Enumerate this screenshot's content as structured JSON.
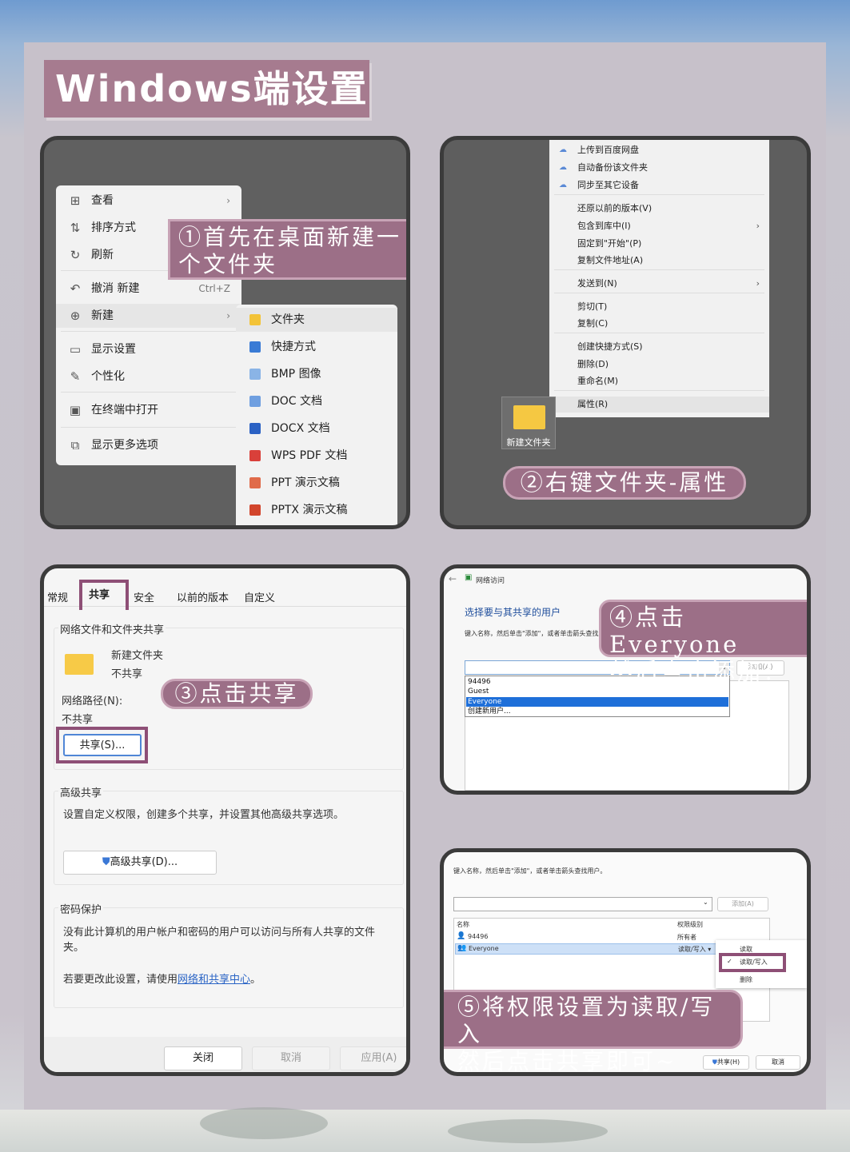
{
  "title": "Windows端设置",
  "panel1": {
    "note": [
      "①首先在桌面新建一",
      "个文件夹"
    ],
    "menu": [
      {
        "icon": "grid-icon",
        "glyph": "⊞",
        "label": "查看",
        "right": "›"
      },
      {
        "icon": "sort-icon",
        "glyph": "⇅",
        "label": "排序方式",
        "right": "›"
      },
      {
        "icon": "refresh-icon",
        "glyph": "↻",
        "label": "刷新",
        "right": ""
      },
      {
        "icon": "undo-icon",
        "glyph": "↶",
        "label": "撤消 新建",
        "right": "Ctrl+Z"
      },
      {
        "icon": "new-icon",
        "glyph": "⊕",
        "label": "新建",
        "right": "›"
      },
      {
        "icon": "display-icon",
        "glyph": "▭",
        "label": "显示设置",
        "right": ""
      },
      {
        "icon": "brush-icon",
        "glyph": "✎",
        "label": "个性化",
        "right": ""
      },
      {
        "icon": "terminal-icon",
        "glyph": "▣",
        "label": "在终端中打开",
        "right": ""
      },
      {
        "icon": "more-options-icon",
        "glyph": "⧉",
        "label": "显示更多选项",
        "right": ""
      }
    ],
    "submenu": [
      {
        "icon": "folder-icon",
        "color": "#f3c338",
        "label": "文件夹"
      },
      {
        "icon": "shortcut-icon",
        "color": "#3a7bd5",
        "label": "快捷方式"
      },
      {
        "icon": "bmp-icon",
        "color": "#8ab4e6",
        "label": "BMP 图像"
      },
      {
        "icon": "doc-icon",
        "color": "#6f9fe0",
        "label": "DOC 文档"
      },
      {
        "icon": "docx-icon",
        "color": "#2b62c4",
        "label": "DOCX 文档"
      },
      {
        "icon": "pdf-icon",
        "color": "#d9403a",
        "label": "WPS PDF 文档"
      },
      {
        "icon": "ppt-icon",
        "color": "#e06b4a",
        "label": "PPT 演示文稿"
      },
      {
        "icon": "pptx-icon",
        "color": "#d2452c",
        "label": "PPTX 演示文稿"
      }
    ]
  },
  "panel2": {
    "note": "②右键文件夹-属性",
    "folder_label": "新建文件夹",
    "menu": [
      {
        "label": "上传到百度网盘",
        "icon": "cloud-icon",
        "arrow": ""
      },
      {
        "label": "自动备份该文件夹",
        "icon": "cloud-icon",
        "arrow": ""
      },
      {
        "label": "同步至其它设备",
        "icon": "cloud-icon",
        "arrow": ""
      },
      {
        "label": "还原以前的版本(V)",
        "icon": "",
        "arrow": ""
      },
      {
        "label": "包含到库中(I)",
        "icon": "",
        "arrow": "›"
      },
      {
        "label": "固定到\"开始\"(P)",
        "icon": "",
        "arrow": ""
      },
      {
        "label": "复制文件地址(A)",
        "icon": "",
        "arrow": ""
      },
      {
        "label": "发送到(N)",
        "icon": "",
        "arrow": "›"
      },
      {
        "label": "剪切(T)",
        "icon": "",
        "arrow": ""
      },
      {
        "label": "复制(C)",
        "icon": "",
        "arrow": ""
      },
      {
        "label": "创建快捷方式(S)",
        "icon": "",
        "arrow": ""
      },
      {
        "label": "删除(D)",
        "icon": "",
        "arrow": ""
      },
      {
        "label": "重命名(M)",
        "icon": "",
        "arrow": ""
      },
      {
        "label": "属性(R)",
        "icon": "",
        "arrow": ""
      }
    ]
  },
  "panel3": {
    "tabs": [
      "常规",
      "共享",
      "安全",
      "以前的版本",
      "自定义"
    ],
    "active_tab": "共享",
    "note": "③点击共享",
    "group1_title": "网络文件和文件夹共享",
    "folder_name": "新建文件夹",
    "folder_status": "不共享",
    "path_label": "网络路径(N):",
    "path_value": "不共享",
    "share_button": "共享(S)...",
    "group2_title": "高级共享",
    "group2_desc": "设置自定义权限，创建多个共享，并设置其他高级共享选项。",
    "advanced_button": "高级共享(D)...",
    "group3_title": "密码保护",
    "group3_desc": "没有此计算机的用户帐户和密码的用户可以访问与所有人共享的文件夹。",
    "group3_link_prefix": "若要更改此设置，请使用",
    "group3_link": "网络和共享中心",
    "group3_link_suffix": "。",
    "buttons": [
      "关闭",
      "取消",
      "应用(A)"
    ]
  },
  "panel4": {
    "window_title": "网络访问",
    "heading": "选择要与其共享的用户",
    "instruction": "键入名称，然后单击\"添加\"，或者单击箭头查找用户。",
    "add_button": "添加(A)",
    "dropdown_items": [
      "94496",
      "Guest",
      "Everyone",
      "创建新用户..."
    ],
    "selected_item": "Everyone",
    "note": [
      "④点击Everyone",
      "然后点击添加！"
    ]
  },
  "panel5": {
    "instruction": "键入名称，然后单击\"添加\"，或者单击箭头查找用户。",
    "add_button": "添加(A)",
    "col_name": "名称",
    "col_perm": "权限级别",
    "rows": [
      {
        "name": "94496",
        "perm": "所有者"
      },
      {
        "name": "Everyone",
        "perm": "读取/写入 ▾"
      }
    ],
    "perm_menu": [
      "读取",
      "读取/写入",
      "删除"
    ],
    "checked_perm": "读取/写入",
    "note": [
      "⑤将权限设置为读取/写入",
      "然后点击共享即可~"
    ],
    "share_button": "共享(H)",
    "cancel_button": "取消"
  }
}
